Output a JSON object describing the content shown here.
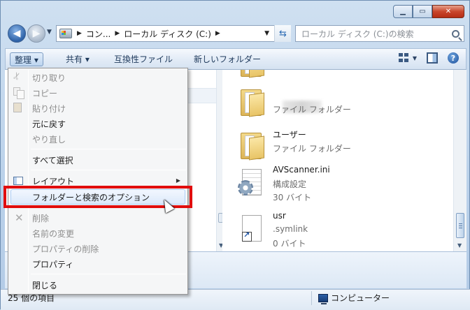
{
  "address_bar": {
    "crumbs": [
      "コン...",
      "ローカル ディスク (C:)"
    ]
  },
  "search": {
    "placeholder": "ローカル ディスク (C:)の検索"
  },
  "toolbar": {
    "organize": "整理 ▾",
    "share": "共有 ▾",
    "compat_files": "互換性ファイル",
    "new_folder": "新しいフォルダー"
  },
  "files": [
    {
      "name": "",
      "type": "ファイル フォルダー",
      "icon": "folder-icon"
    },
    {
      "name": "",
      "type": "ファイル フォルダー",
      "icon": "folder-icon"
    },
    {
      "name": "ユーザー",
      "type": "ファイル フォルダー",
      "icon": "folder-icon"
    },
    {
      "name": "AVScanner.ini",
      "type": "構成設定",
      "size": "30 バイト",
      "icon": "config-file-icon"
    },
    {
      "name": "usr",
      "type": ".symlink",
      "size": "0 バイト",
      "icon": "shortcut-file-icon"
    }
  ],
  "context_menu": {
    "items": [
      {
        "label": "切り取り",
        "enabled": false,
        "icon": "scissors-icon"
      },
      {
        "label": "コピー",
        "enabled": false,
        "icon": "copy-icon"
      },
      {
        "label": "貼り付け",
        "enabled": false,
        "icon": "paste-icon"
      },
      {
        "label": "元に戻す",
        "enabled": true
      },
      {
        "label": "やり直し",
        "enabled": false
      },
      {
        "label": "すべて選択",
        "enabled": true
      },
      {
        "label": "レイアウト",
        "enabled": true,
        "icon": "layout-icon",
        "submenu": true
      },
      {
        "label": "フォルダーと検索のオプション",
        "enabled": true,
        "highlighted": true
      },
      {
        "label": "削除",
        "enabled": false,
        "icon": "delete-icon"
      },
      {
        "label": "名前の変更",
        "enabled": false
      },
      {
        "label": "プロパティの削除",
        "enabled": false
      },
      {
        "label": "プロパティ",
        "enabled": true
      },
      {
        "label": "閉じる",
        "enabled": true
      }
    ]
  },
  "status": {
    "item_count": "25 個の項目",
    "location": "コンピューター"
  },
  "colors": {
    "highlight_box": "#e10d0d",
    "window_frame": "#b9d1ea"
  }
}
